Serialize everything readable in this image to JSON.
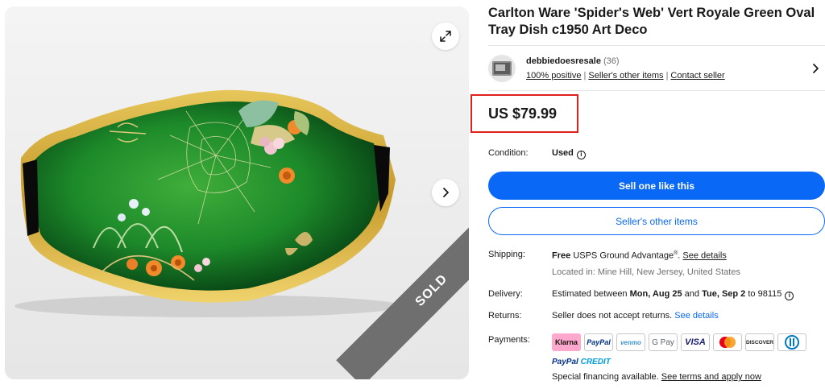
{
  "listing": {
    "title": "Carlton Ware 'Spider's Web' Vert Royale Green Oval Tray Dish c1950 Art Deco",
    "sold_label": "SOLD"
  },
  "seller": {
    "name": "debbiedoesresale",
    "count": "(36)",
    "positive": "100% positive",
    "other_items": "Seller's other items",
    "contact": "Contact seller"
  },
  "price": "US $79.99",
  "condition": {
    "label": "Condition:",
    "value": "Used"
  },
  "buttons": {
    "primary": "Sell one like this",
    "secondary": "Seller's other items"
  },
  "shipping": {
    "label": "Shipping:",
    "free": "Free",
    "service": "USPS Ground Advantage",
    "reg": "®",
    "link": "See details",
    "location": "Located in: Mine Hill, New Jersey, United States"
  },
  "delivery": {
    "label": "Delivery:",
    "prefix": "Estimated between",
    "start": "Mon, Aug 25",
    "and": "and",
    "end": "Tue, Sep 2",
    "to": "to 98115"
  },
  "returns": {
    "label": "Returns:",
    "text": "Seller does not accept returns.",
    "link": "See details"
  },
  "payments": {
    "label": "Payments:",
    "methods": [
      "Klarna",
      "PayPal",
      "venmo",
      "G Pay",
      "VISA",
      "Mastercard",
      "DISCOVER",
      "Diners Club"
    ],
    "paypal_credit_1": "PayPal",
    "paypal_credit_2": "CREDIT",
    "special_text": "Special financing available.",
    "special_link": "See terms and apply now"
  },
  "colors": {
    "accent": "#0968f6",
    "price_highlight": "#e0201b",
    "sold_ribbon": "#6f6f6f"
  },
  "icons": [
    "expand-icon",
    "chevron-right-icon",
    "info-icon",
    "seller-avatar"
  ]
}
